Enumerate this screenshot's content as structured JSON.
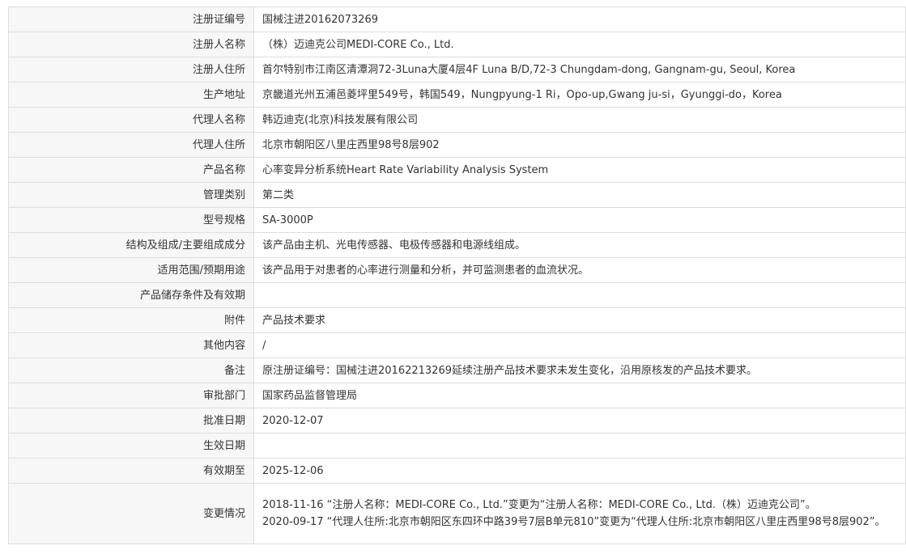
{
  "rows": [
    {
      "label": "注册证编号",
      "value": "国械注进20162073269"
    },
    {
      "label": "注册人名称",
      "value": "（株）迈迪克公司MEDI-CORE Co., Ltd."
    },
    {
      "label": "注册人住所",
      "value": "首尔特别市江南区清潭洞72-3Luna大厦4层4F Luna B/D,72-3 Chungdam-dong, Gangnam-gu, Seoul, Korea"
    },
    {
      "label": "生产地址",
      "value": "京畿道光州五浦邑菱坪里549号，韩国549，Nungpyung-1 Ri，Opo-up,Gwang ju-si，Gyunggi-do，Korea"
    },
    {
      "label": "代理人名称",
      "value": "韩迈迪克(北京)科技发展有限公司"
    },
    {
      "label": "代理人住所",
      "value": "北京市朝阳区八里庄西里98号8层902"
    },
    {
      "label": "产品名称",
      "value": "心率变异分析系统Heart Rate Variability Analysis System"
    },
    {
      "label": "管理类别",
      "value": "第二类"
    },
    {
      "label": "型号规格",
      "value": "SA-3000P"
    },
    {
      "label": "结构及组成/主要组成成分",
      "value": "该产品由主机、光电传感器、电极传感器和电源线组成。"
    },
    {
      "label": "适用范围/预期用途",
      "value": "该产品用于对患者的心率进行测量和分析，并可监测患者的血流状况。"
    },
    {
      "label": "产品储存条件及有效期",
      "value": ""
    },
    {
      "label": "附件",
      "value": "产品技术要求"
    },
    {
      "label": "其他内容",
      "value": "/"
    },
    {
      "label": "备注",
      "value": "原注册证编号：国械注进20162213269延续注册产品技术要求未发生变化，沿用原核发的产品技术要求。"
    },
    {
      "label": "审批部门",
      "value": "国家药品监督管理局"
    },
    {
      "label": "批准日期",
      "value": "2020-12-07"
    },
    {
      "label": "生效日期",
      "value": ""
    },
    {
      "label": "有效期至",
      "value": "2025-12-06"
    }
  ],
  "changes": {
    "label": "变更情况",
    "entries": [
      "2018-11-16 “注册人名称：MEDI-CORE Co., Ltd.”变更为“注册人名称：MEDI-CORE Co., Ltd.（株）迈迪克公司”。",
      "2020-09-17 “代理人住所:北京市朝阳区东四环中路39号7层B单元810”变更为“代理人住所:北京市朝阳区八里庄西里98号8层902”。"
    ]
  }
}
